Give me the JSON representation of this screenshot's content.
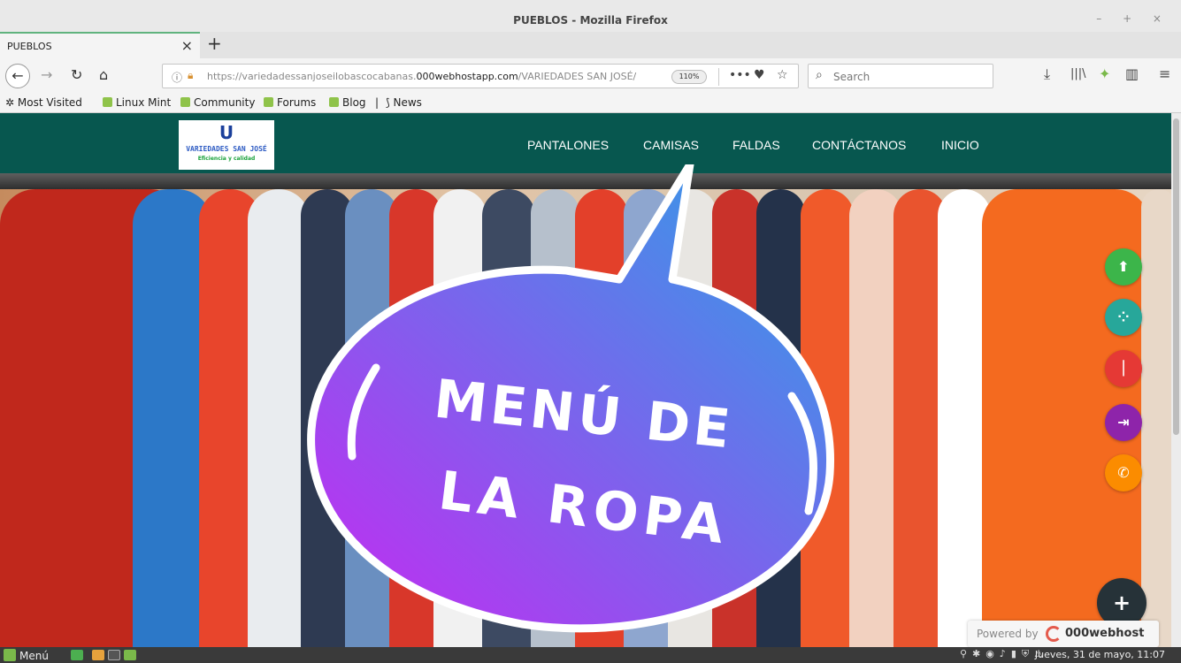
{
  "window": {
    "title": "PUEBLOS - Mozilla Firefox",
    "controls": "– + ×"
  },
  "tab": {
    "title": "PUEBLOS",
    "close": "×",
    "new_tab": "+"
  },
  "nav": {
    "back": "←",
    "forward": "→",
    "reload": "↻",
    "home": "⌂",
    "url_prefix": "https://variedadessanjoseilobascocabanas.",
    "url_domain": "000webhostapp.com",
    "url_suffix": "/VARIEDADES SAN JOSÉ/",
    "zoom": "110%",
    "page_actions": "•••",
    "pocket": "♥",
    "star": "☆",
    "search_placeholder": "Search",
    "download": "⤓",
    "library": "|||\\",
    "extension": "✦",
    "sidebar": "▥",
    "menu": "≡"
  },
  "bookmarks": [
    {
      "label": "Most Visited",
      "icon": "gear-icon"
    },
    {
      "label": "Linux Mint",
      "icon": "mint-icon"
    },
    {
      "label": "Community",
      "icon": "mint-icon"
    },
    {
      "label": "Forums",
      "icon": "mint-icon"
    },
    {
      "label": "Blog",
      "icon": "mint-icon"
    },
    {
      "label": "News",
      "icon": "rss-icon"
    }
  ],
  "site": {
    "logo": {
      "mark": "U",
      "name": "VARIEDADES SAN JOSÉ",
      "tagline": "Eficiencia y calidad"
    },
    "menu": [
      "PANTALONES",
      "CAMISAS",
      "FALDAS",
      "CONTÁCTANOS",
      "INICIO"
    ],
    "hero_line1": "MENÚ DE",
    "hero_line2": "LA ROPA"
  },
  "fabs": [
    {
      "name": "upload-icon",
      "glyph": "⬆",
      "color": "#3cb54a"
    },
    {
      "name": "grid-icon",
      "glyph": "⁘",
      "color": "#27a79a"
    },
    {
      "name": "audio-icon",
      "glyph": "⏐",
      "color": "#e53935"
    },
    {
      "name": "exit-icon",
      "glyph": "⇥",
      "color": "#8e24aa"
    },
    {
      "name": "phone-icon",
      "glyph": "✆",
      "color": "#fb8c00"
    },
    {
      "name": "add-icon",
      "glyph": "+",
      "color": "#263238"
    }
  ],
  "powered": {
    "by": "Powered by",
    "brand": "000webhost"
  },
  "taskbar": {
    "menu_label": "Menú",
    "clock": "Jueves, 31 de mayo, 11:07"
  },
  "colors": {
    "header": "#07574f",
    "bubble_start": "#c629f2",
    "bubble_end": "#2aa3e6"
  }
}
